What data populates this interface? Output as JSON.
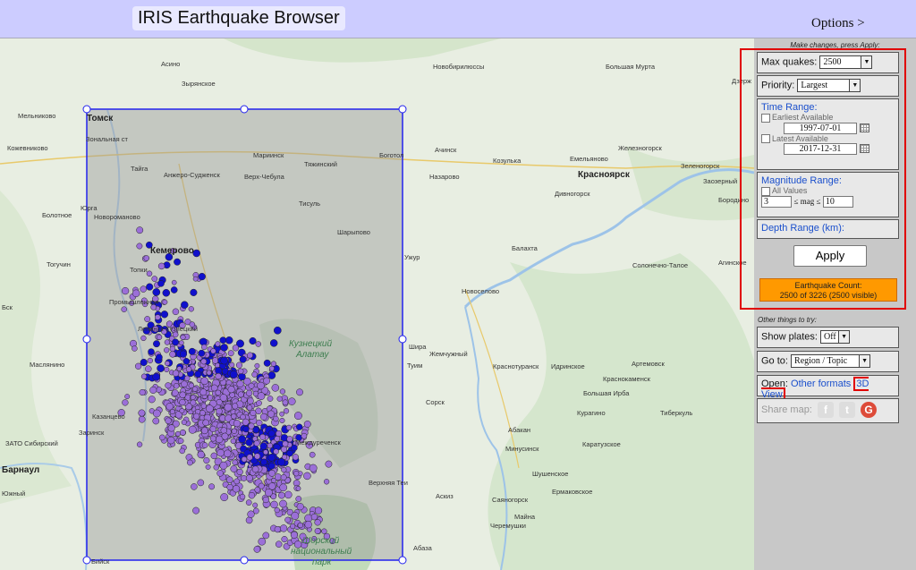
{
  "header": {
    "title": "IRIS Earthquake Browser",
    "options_label": "Options >"
  },
  "map": {
    "labels": [
      {
        "t": "Асино"
      },
      {
        "t": "Зырянское"
      },
      {
        "t": "Томск"
      },
      {
        "t": "Мельниково"
      },
      {
        "t": "Кожевниково"
      },
      {
        "t": "Зональная ст"
      },
      {
        "t": "Мариинск"
      },
      {
        "t": "Тяжинский"
      },
      {
        "t": "Боготол"
      },
      {
        "t": "Ачинск"
      },
      {
        "t": "Козулька"
      },
      {
        "t": "Емельяново"
      },
      {
        "t": "Железногорск"
      },
      {
        "t": "Красноярск"
      },
      {
        "t": "Зеленогорск"
      },
      {
        "t": "Тайга"
      },
      {
        "t": "Анжеро-Судженск"
      },
      {
        "t": "Верх-Чебула"
      },
      {
        "t": "Назарово"
      },
      {
        "t": "Дивногорск"
      },
      {
        "t": "Заозерный"
      },
      {
        "t": "Бородино"
      },
      {
        "t": "Юрга"
      },
      {
        "t": "Новоромановo"
      },
      {
        "t": "Тисуль"
      },
      {
        "t": "Болотное"
      },
      {
        "t": "Кемерово"
      },
      {
        "t": "Шарыпово"
      },
      {
        "t": "Топки"
      },
      {
        "t": "Тогучин"
      },
      {
        "t": "Ужур"
      },
      {
        "t": "Балахта"
      },
      {
        "t": "Солонечно-Талое"
      },
      {
        "t": "Агинское"
      },
      {
        "t": "Новоселово"
      },
      {
        "t": "Промышленная"
      },
      {
        "t": "Ленинск-Кузнецкий"
      },
      {
        "t": "Кузнецкий"
      },
      {
        "t": "Алатау"
      },
      {
        "t": "Шира"
      },
      {
        "t": "Жемчужный"
      },
      {
        "t": "Туим"
      },
      {
        "t": "Маслянино"
      },
      {
        "t": "Краснотуранск"
      },
      {
        "t": "Идринское"
      },
      {
        "t": "Артемовск"
      },
      {
        "t": "Краснокаменск"
      },
      {
        "t": "Большая Ирба"
      },
      {
        "t": "Сорск"
      },
      {
        "t": "Курагино"
      },
      {
        "t": "Тиберкуль"
      },
      {
        "t": "Казанцево"
      },
      {
        "t": "Заринск"
      },
      {
        "t": "Абакан"
      },
      {
        "t": "Минусинск"
      },
      {
        "t": "Каратузское"
      },
      {
        "t": "Междуреченск"
      },
      {
        "t": "ЗАТО Сибирский"
      },
      {
        "t": "Барнаул"
      },
      {
        "t": "Шушенское"
      },
      {
        "t": "Южный"
      },
      {
        "t": "Верхняя Теи"
      },
      {
        "t": "Аскиз"
      },
      {
        "t": "Саяногорск"
      },
      {
        "t": "Ермаковское"
      },
      {
        "t": "Майна"
      },
      {
        "t": "Черемушки"
      },
      {
        "t": "Шорский"
      },
      {
        "t": "национальный"
      },
      {
        "t": "парк"
      },
      {
        "t": "Абаза"
      },
      {
        "t": "Бийск"
      },
      {
        "t": "Новобирилюссы"
      },
      {
        "t": "Большая Мурта"
      },
      {
        "t": "Дзерж"
      },
      {
        "t": "Бск"
      }
    ]
  },
  "panel": {
    "hint_top": "Make changes, press Apply:",
    "max_quakes": {
      "label": "Max quakes:",
      "value": "2500"
    },
    "priority": {
      "label": "Priority:",
      "value": "Largest"
    },
    "time_range": {
      "heading": "Time Range:",
      "earliest_label": "Earliest Available",
      "start_date": "1997-07-01",
      "latest_label": "Latest Available",
      "end_date": "2017-12-31"
    },
    "magnitude": {
      "heading": "Magnitude Range:",
      "all_label": "All Values",
      "min": "3",
      "mid_label": "≤ mag ≤",
      "max": "10"
    },
    "depth": {
      "heading": "Depth Range (km):"
    },
    "apply_label": "Apply",
    "count": {
      "line1": "Earthquake Count:",
      "line2": "2500 of 3226 (2500 visible)"
    },
    "hint_other": "Other things to try:",
    "plates": {
      "label": "Show plates:",
      "value": "Off"
    },
    "goto": {
      "label": "Go to:",
      "value": "Region / Topic"
    },
    "open": {
      "label": "Open:",
      "formats": "Other formats",
      "view3d": "3D View"
    },
    "share": {
      "label": "Share map:"
    }
  },
  "colors": {
    "accent_blue": "#1a4fcc",
    "selection_border": "#2222ee",
    "count_orange": "#ff9900",
    "quake_purple": "#9b6fd8",
    "quake_blue": "#1010cc",
    "highlight_red": "#e00000"
  },
  "icons": {
    "facebook": "facebook-icon",
    "twitter": "twitter-icon",
    "google": "google-plus-icon"
  }
}
